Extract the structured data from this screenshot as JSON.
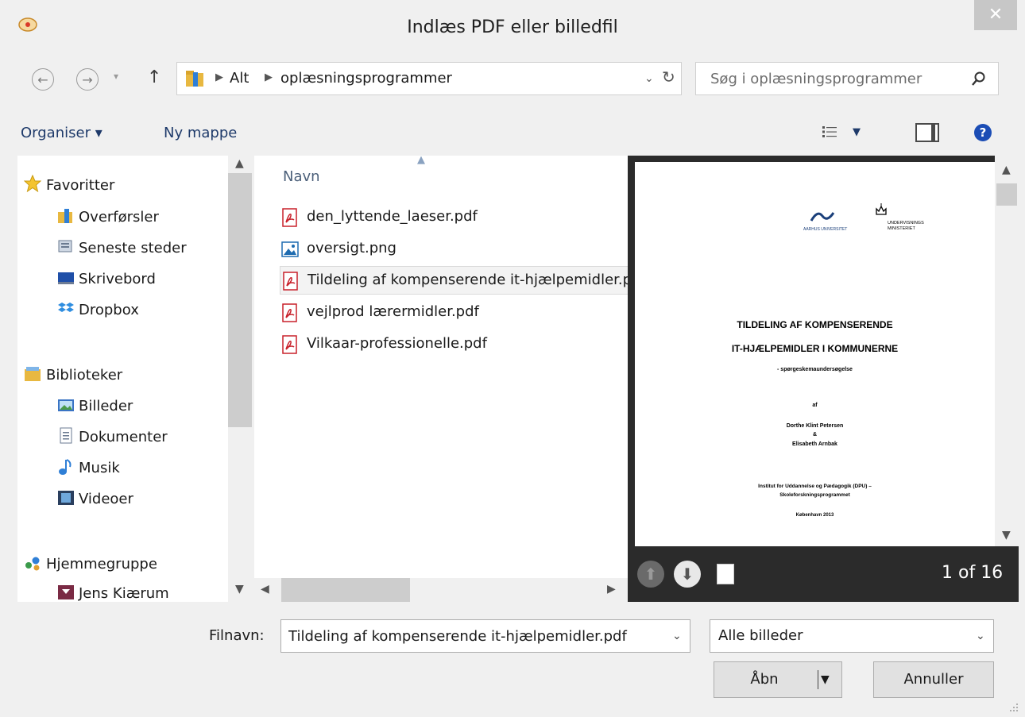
{
  "window": {
    "title": "Indlæs PDF eller billedfil",
    "close_glyph": "✕"
  },
  "address": {
    "crumbs": [
      "Alt",
      "oplæsningsprogrammer"
    ],
    "search_placeholder": "Søg i oplæsningsprogrammer"
  },
  "toolbar": {
    "organize": "Organiser ▾",
    "new_folder": "Ny mappe"
  },
  "nav": {
    "favorites": "Favoritter",
    "fav_items": [
      "Overførsler",
      "Seneste steder",
      "Skrivebord",
      "Dropbox"
    ],
    "libraries": "Biblioteker",
    "lib_items": [
      "Billeder",
      "Dokumenter",
      "Musik",
      "Videoer"
    ],
    "homegroup": "Hjemmegruppe",
    "homegroup_items": [
      "Jens Kiærum"
    ]
  },
  "files": {
    "column": "Navn",
    "items": [
      {
        "name": "den_lyttende_laeser.pdf",
        "type": "pdf"
      },
      {
        "name": "oversigt.png",
        "type": "png"
      },
      {
        "name": "Tildeling af kompenserende it-hjælpemidler.pdf",
        "type": "pdf",
        "selected": true
      },
      {
        "name": "vejlprod lærermidler.pdf",
        "type": "pdf"
      },
      {
        "name": "Vilkaar-professionelle.pdf",
        "type": "pdf"
      }
    ]
  },
  "preview": {
    "logo_left": "AARHUS UNIVERSITET",
    "logo_right": "UNDERVISNINGS MINISTERIET",
    "title1": "TILDELING AF KOMPENSERENDE",
    "title2": "IT-HJÆLPEMIDLER I KOMMUNERNE",
    "subtitle": "- spørgeskemaundersøgelse",
    "by": "af",
    "author1": "Dorthe Klint Petersen",
    "amp": "&",
    "author2": "Elisabeth Arnbak",
    "inst1": "Institut for Uddannelse og Pædagogik (DPU) –",
    "inst2": "Skoleforskningsprogrammet",
    "place": "København 2013",
    "page_count": "1 of 16"
  },
  "bottom": {
    "filename_label": "Filnavn:",
    "filename_value": "Tildeling af kompenserende it-hjælpemidler.pdf",
    "filetype": "Alle billeder",
    "open": "Åbn",
    "cancel": "Annuller"
  },
  "colors": {
    "link_blue": "#1e3a6a",
    "pdf_red": "#c8202a",
    "preview_bg": "#2b2b2b",
    "help_blue": "#1b4db5"
  }
}
